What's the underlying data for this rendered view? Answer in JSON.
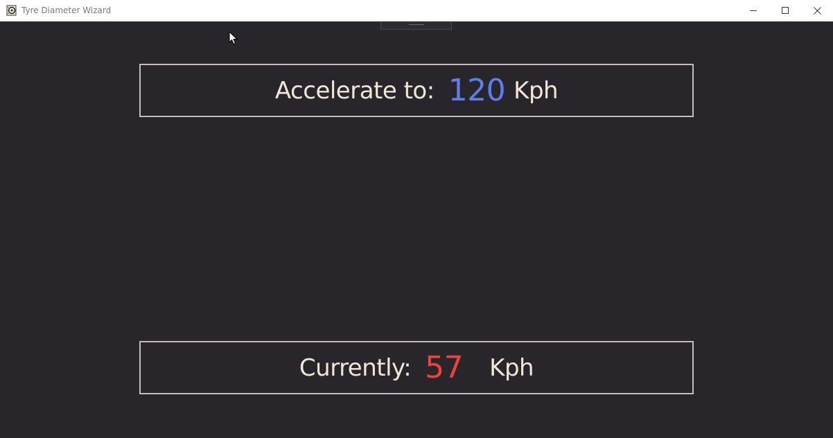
{
  "window": {
    "title": "Tyre Diameter Wizard",
    "icon": "app-icon",
    "controls": [
      "minimize-icon",
      "maximize-icon",
      "close-icon"
    ]
  },
  "target": {
    "label": "Accelerate to:",
    "value": "120",
    "unit": "Kph",
    "value_color": "#5b7ff0"
  },
  "current": {
    "label": "Currently:",
    "value": "57",
    "unit": "Kph",
    "value_color": "#f0413f"
  },
  "colors": {
    "background": "#29262b",
    "text": "#f2e6d6",
    "panel_border": "#c9b9c0"
  }
}
